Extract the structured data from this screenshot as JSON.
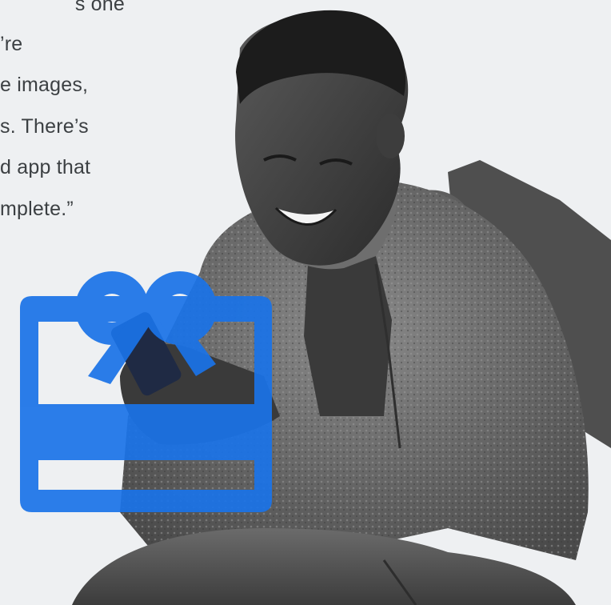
{
  "quote": {
    "lines": [
      "s one",
      "’re",
      "e images,",
      "s. There’s",
      "d app that",
      "mplete.”"
    ]
  },
  "photo": {
    "subject": "smiling man wearing fleece jacket and backpack using smartphone",
    "style": "grayscale"
  },
  "icons": {
    "gift_card": {
      "name": "gift-card-icon",
      "color": "#1a73e8"
    }
  },
  "colors": {
    "background": "#eef0f2",
    "accent": "#1a73e8",
    "text": "#3c4043"
  }
}
